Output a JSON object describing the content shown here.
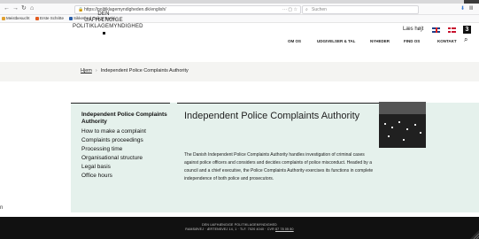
{
  "browser": {
    "url": "https://politiklagemyndigheden.dk/english/",
    "search_placeholder": "Suchen",
    "bookmarks": [
      "Meistbesucht",
      "Erste Schritte",
      "Sikkerhed Online Banki..."
    ],
    "icons": {
      "back": "back-arrow-icon",
      "forward": "forward-arrow-icon",
      "reload": "reload-icon",
      "home": "home-icon",
      "more": "more-dots-icon",
      "pocket": "pocket-icon",
      "bookmark": "bookmark-star-icon",
      "download": "download-icon",
      "library": "library-icon"
    }
  },
  "site": {
    "logo_lines": [
      "DEN",
      "UAFHÆNGIGE",
      "POLITIKLAGEMYNDIGHED"
    ],
    "nav": [
      "OM OS",
      "UDGIVELSER & TAL",
      "NYHEDER",
      "FIND OS",
      "KONTAKT"
    ],
    "lang_label": "Læs højt",
    "badge": "3",
    "colors": {
      "content_band": "#e5f1ec",
      "footer": "#111111",
      "breadcrumb_band": "#f4f4f2"
    }
  },
  "breadcrumb": {
    "home": "Hjem",
    "separator": "›",
    "current": "Independent Police Complaints Authority"
  },
  "sidenav": {
    "active": "Independent Police Complaints Authority",
    "items": [
      "How to make a complaint",
      "Complaints proceedings",
      "Processing time",
      "Organisational structure",
      "Legal basis",
      "Office hours"
    ]
  },
  "main": {
    "heading": "Independent Police Complaints Authority",
    "body": "The Danish Independent Police Complaints Authority handles investigation of criminal cases against police officers and considers and decides complaints of police misconduct. Headed by a council and a chief executive, the Police Complaints Authority exercises its functions in complete independence of both police and prosecutors."
  },
  "side_text": "n",
  "footer": {
    "line1": "DEN UAFHÆNGIGE POLITIKLAGEMYNDIGHED",
    "line2_prefix": "RAMSØVEJ · ÆRTENSVEJ 14, 1 · TLF. 7020 4040 · CVR ",
    "cvr": "87 78 05 80"
  }
}
